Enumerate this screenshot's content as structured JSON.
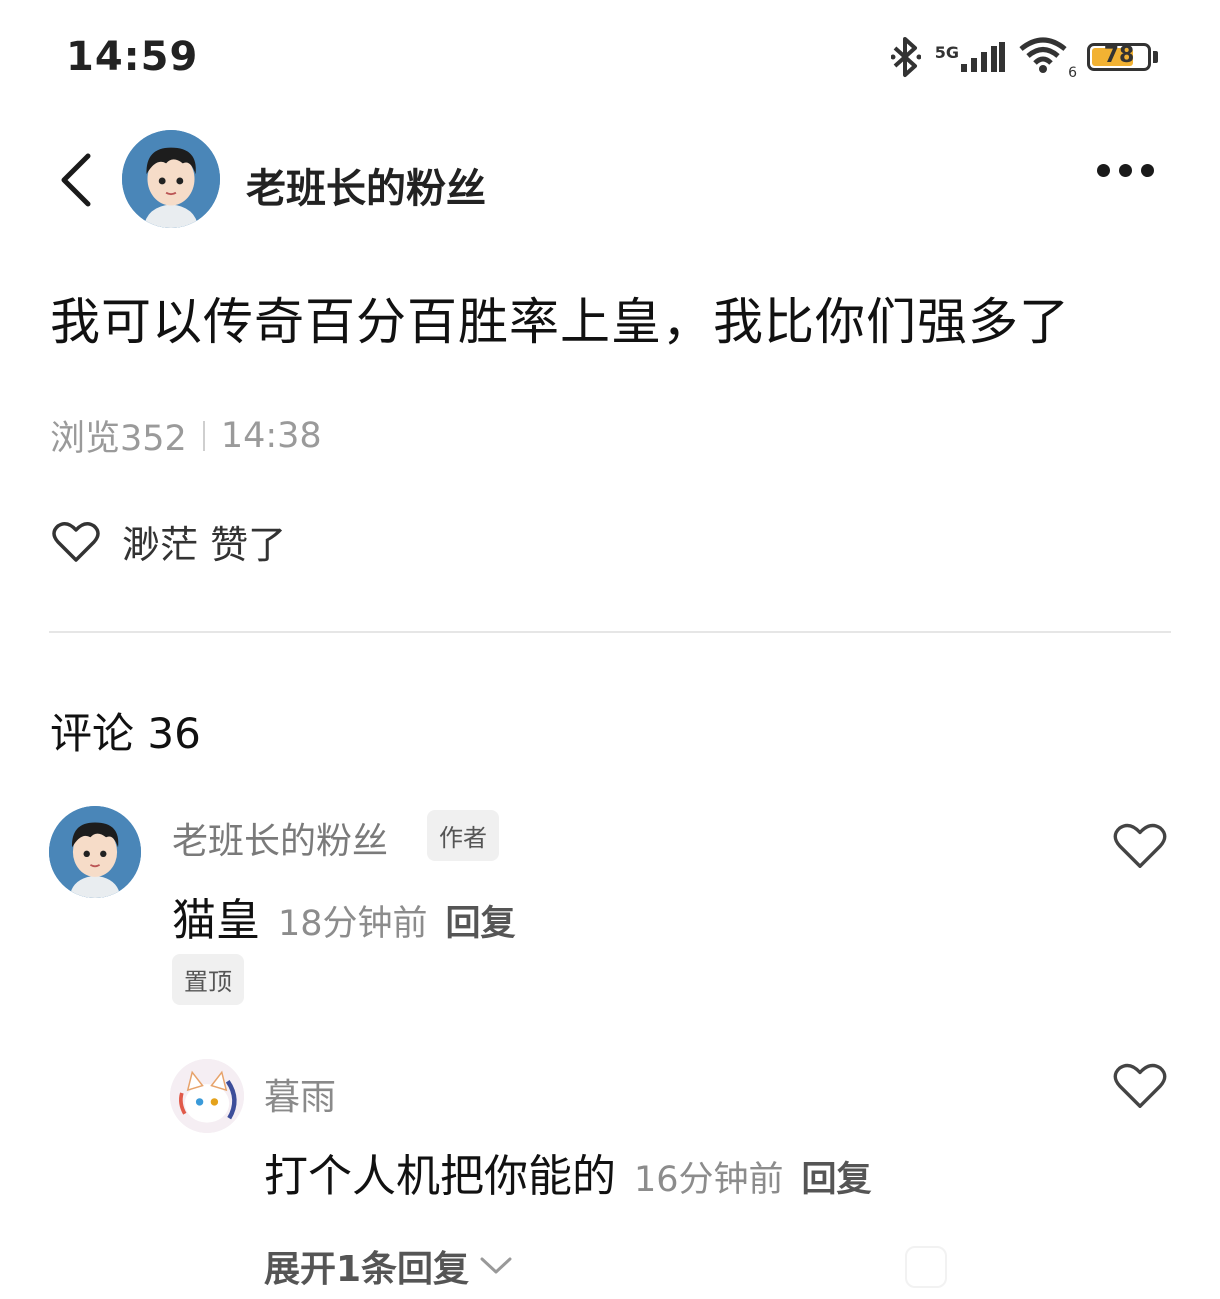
{
  "status_bar": {
    "time": "14:59",
    "network": "5G",
    "wifi_index": "6",
    "battery": "78",
    "battery_level": 0.78,
    "battery_color": "#f2b233"
  },
  "header": {
    "back_icon": "chevron-left-icon",
    "author_name": "老班长的粉丝",
    "more_icon": "more-dots-icon"
  },
  "post": {
    "text": "我可以传奇百分百胜率上皇，我比你们强多了",
    "views": "浏览352",
    "time": "14:38",
    "like_text": "渺茫 赞了"
  },
  "comments": {
    "title": "评论 36",
    "items": [
      {
        "name": "老班长的粉丝",
        "badge": "作者",
        "text": "猫皇",
        "time": "18分钟前",
        "reply": "回复",
        "pin": "置顶"
      }
    ],
    "replies": [
      {
        "name": "暮雨",
        "text": "打个人机把你能的",
        "time": "16分钟前",
        "reply": "回复"
      }
    ],
    "expand": "展开1条回复"
  }
}
